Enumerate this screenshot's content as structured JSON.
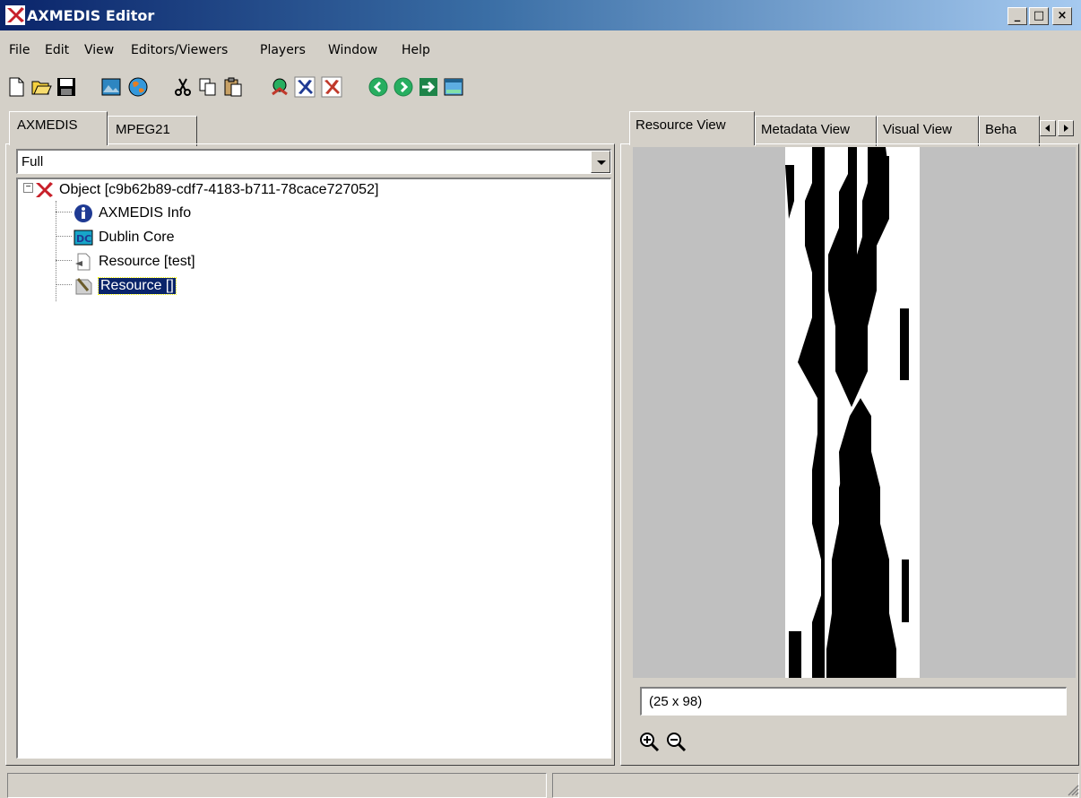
{
  "window": {
    "title": "AXMEDIS Editor",
    "minimize": "_",
    "maximize": "□",
    "close": "×"
  },
  "menu": {
    "items": [
      "File",
      "Edit",
      "View",
      "Editors/Viewers",
      "Players",
      "Window",
      "Help"
    ]
  },
  "toolbar": {
    "icons": [
      "new-document-icon",
      "open-folder-icon",
      "save-disk-icon",
      "image-icon",
      "globe-icon",
      "cut-icon",
      "copy-icon",
      "paste-icon",
      "network-icon",
      "axmedis-tool-icon",
      "axmedis-tool-red-icon",
      "back-icon",
      "forward-icon",
      "export-arrow-icon",
      "window-icon"
    ]
  },
  "left": {
    "tabs": [
      "AXMEDIS",
      "MPEG21"
    ],
    "filter": {
      "value": "Full"
    },
    "tree": {
      "root": "Object [c9b62b89-cdf7-4183-b711-78cace727052]",
      "children": [
        "AXMEDIS Info",
        "Dublin Core",
        "Resource [test]",
        "Resource []"
      ]
    }
  },
  "right": {
    "tabs": [
      "Resource View",
      "Metadata View",
      "Visual View",
      "Beha"
    ],
    "image_size": "(25 x 98)",
    "zoom_in_icon": "zoom-in-icon",
    "zoom_out_icon": "zoom-out-icon"
  },
  "colors": {
    "titlebar_start": "#0a246a",
    "titlebar_end": "#a6caf0",
    "face": "#d4d0c8",
    "selection": "#0a246a"
  }
}
